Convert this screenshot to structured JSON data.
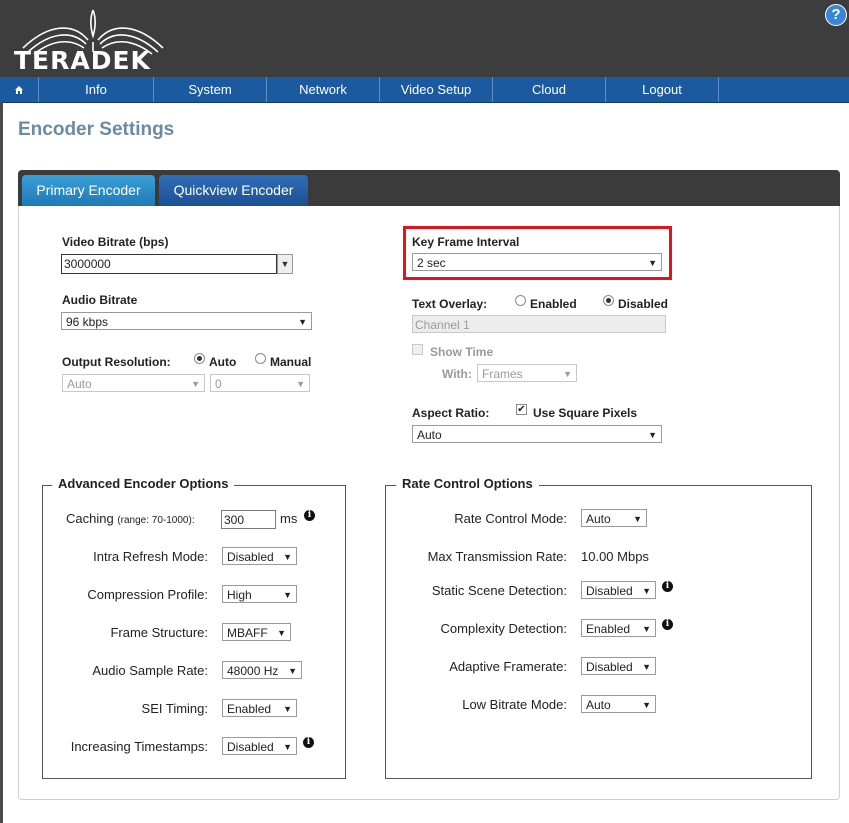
{
  "brand": {
    "logo_text": "TERADEK"
  },
  "help": {
    "icon": "question-icon",
    "label": "?"
  },
  "nav": {
    "home_icon": "home-icon",
    "items": [
      "Info",
      "System",
      "Network",
      "Video Setup",
      "Cloud",
      "Logout"
    ]
  },
  "page": {
    "title": "Encoder Settings"
  },
  "tabs": [
    "Primary Encoder",
    "Quickview Encoder"
  ],
  "left": {
    "video_bitrate_label": "Video Bitrate (bps)",
    "video_bitrate_value": "3000000",
    "audio_bitrate_label": "Audio Bitrate",
    "audio_bitrate_value": "96 kbps",
    "output_resolution_label": "Output Resolution:",
    "auto_label": "Auto",
    "manual_label": "Manual",
    "resolution_select": "Auto",
    "resolution_value_select": "0"
  },
  "right": {
    "key_frame_label": "Key Frame Interval",
    "key_frame_value": "2 sec",
    "text_overlay_label": "Text Overlay:",
    "enabled_label": "Enabled",
    "disabled_label": "Disabled",
    "overlay_text": "Channel 1",
    "show_time_label": "Show Time",
    "with_label": "With:",
    "with_value": "Frames",
    "aspect_ratio_label": "Aspect Ratio:",
    "square_pixels_label": "Use Square Pixels",
    "aspect_value": "Auto"
  },
  "advanced": {
    "legend": "Advanced Encoder Options",
    "caching_label": "Caching",
    "caching_range": "(range: 70-1000):",
    "caching_value": "300",
    "caching_unit": "ms",
    "rows": [
      {
        "label": "Intra Refresh Mode:",
        "value": "Disabled"
      },
      {
        "label": "Compression Profile:",
        "value": "High"
      },
      {
        "label": "Frame Structure:",
        "value": "MBAFF"
      },
      {
        "label": "Audio Sample Rate:",
        "value": "48000 Hz"
      },
      {
        "label": "SEI Timing:",
        "value": "Enabled"
      },
      {
        "label": "Increasing Timestamps:",
        "value": "Disabled"
      }
    ]
  },
  "rate": {
    "legend": "Rate Control Options",
    "rate_mode_label": "Rate Control Mode:",
    "rate_mode_value": "Auto",
    "max_rate_label": "Max Transmission Rate:",
    "max_rate_value": "10.00 Mbps",
    "static_label": "Static Scene Detection:",
    "static_value": "Disabled",
    "complexity_label": "Complexity Detection:",
    "complexity_value": "Enabled",
    "adaptive_label": "Adaptive Framerate:",
    "adaptive_value": "Disabled",
    "low_bitrate_label": "Low Bitrate Mode:",
    "low_bitrate_value": "Auto"
  },
  "colors": {
    "nav": "#1c5aa0",
    "tab_active": "#2a8fc9",
    "highlight": "#e0141f",
    "title": "#6a8aa6"
  }
}
